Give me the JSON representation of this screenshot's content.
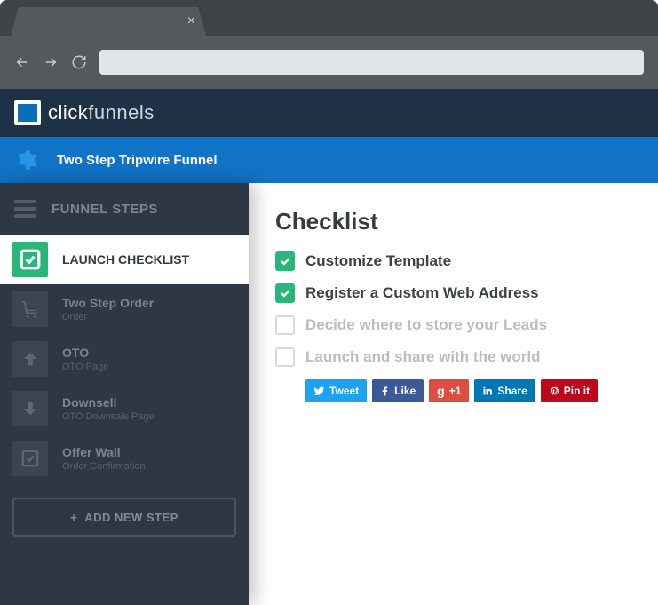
{
  "brand": {
    "click": "click",
    "funnels": "funnels"
  },
  "funnel": {
    "title": "Two Step Tripwire Funnel"
  },
  "sidebar": {
    "header": "FUNNEL STEPS",
    "items": [
      {
        "icon": "check",
        "label": "LAUNCH CHECKLIST",
        "sub": "",
        "active": true
      },
      {
        "icon": "cart",
        "label": "Two Step Order",
        "sub": "Order"
      },
      {
        "icon": "up",
        "label": "OTO",
        "sub": "OTO Page"
      },
      {
        "icon": "down",
        "label": "Downsell",
        "sub": "OTO Downsale Page"
      },
      {
        "icon": "check",
        "label": "Offer Wall",
        "sub": "Order Confirmation"
      }
    ],
    "add": "ADD NEW STEP"
  },
  "main": {
    "heading": "Checklist",
    "items": [
      {
        "checked": true,
        "label": "Customize Template"
      },
      {
        "checked": true,
        "label": "Register a Custom Web Address"
      },
      {
        "checked": false,
        "label": "Decide where to store your Leads"
      },
      {
        "checked": false,
        "label": "Launch and share with the world"
      }
    ],
    "share": {
      "tweet": "Tweet",
      "like": "Like",
      "plusone": "+1",
      "share": "Share",
      "pinit": "Pin it"
    }
  }
}
